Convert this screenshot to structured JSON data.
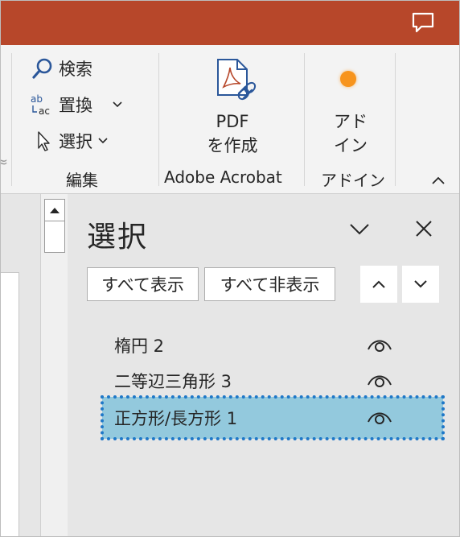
{
  "ribbon": {
    "editing": {
      "find_label": "検索",
      "replace_label": "置換",
      "select_label": "選択",
      "group_label": "編集"
    },
    "acrobat": {
      "create_pdf_label_line1": "PDF",
      "create_pdf_label_line2": "を作成",
      "group_label": "Adobe Acrobat"
    },
    "addins": {
      "addin_label_line1": "アド",
      "addin_label_line2": "イン",
      "group_label": "アドイン"
    },
    "dialog_launcher": "≈"
  },
  "selection_pane": {
    "title": "選択",
    "show_all_label": "すべて表示",
    "hide_all_label": "すべて非表示",
    "items": [
      {
        "label": "楕円 2",
        "selected": false
      },
      {
        "label": "二等辺三角形 3",
        "selected": false
      },
      {
        "label": "正方形/長方形 1",
        "selected": true
      }
    ]
  },
  "colors": {
    "titlebar": "#b7472a",
    "selected_row": "#93c9dd",
    "selection_outline": "#1f78c8",
    "addin_dot": "#f7941d"
  }
}
